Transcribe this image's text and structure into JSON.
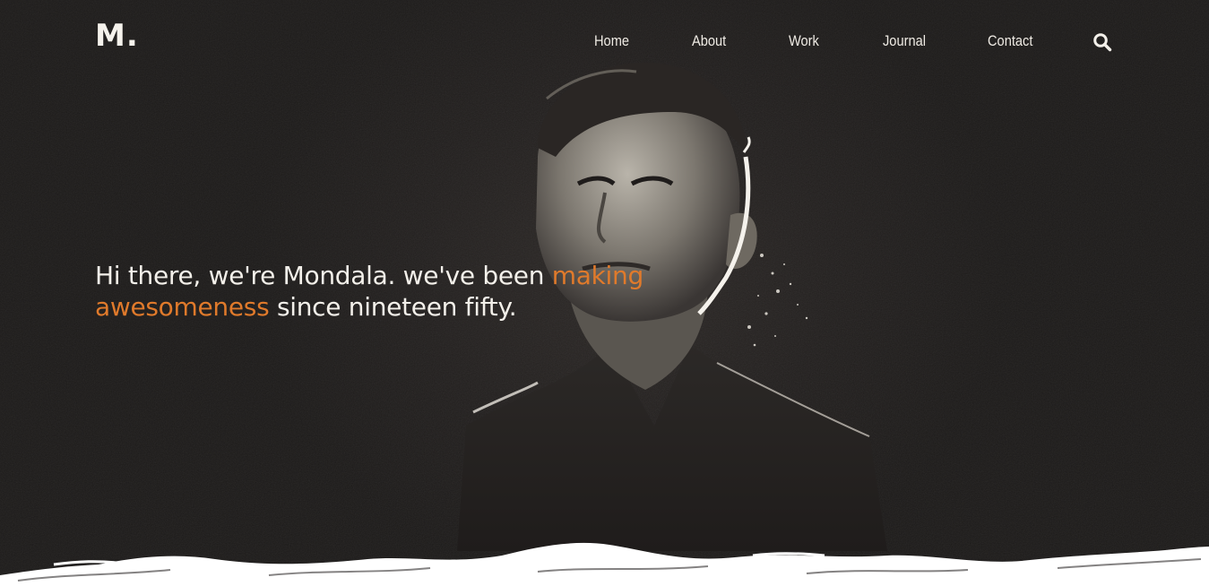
{
  "brand": {
    "logo": "M."
  },
  "nav": {
    "items": [
      {
        "label": "Home"
      },
      {
        "label": "About"
      },
      {
        "label": "Work"
      },
      {
        "label": "Journal"
      },
      {
        "label": "Contact"
      }
    ],
    "search_icon": "search-icon"
  },
  "hero": {
    "headline_part1": "Hi there, we're Mondala. we've been ",
    "headline_accent": "making awesomeness",
    "headline_part2": " since nineteen fifty.",
    "image": "portrait-photo"
  },
  "colors": {
    "background": "#1f1c1b",
    "text": "#f3f0ea",
    "accent": "#e07a2b",
    "wave": "#ffffff"
  }
}
